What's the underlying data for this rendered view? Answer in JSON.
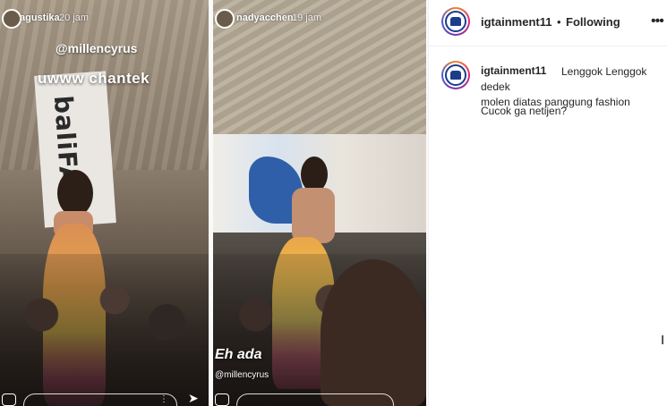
{
  "stories": [
    {
      "username": "agustika",
      "time": "20 jam",
      "mention": "@millencyrus",
      "caption": "uwww chantek",
      "banner_text": "baliFAS"
    },
    {
      "username": "nadyacchen",
      "time": "19 jam",
      "caption": "Eh ada",
      "mention": "@millencyrus"
    }
  ],
  "post": {
    "username": "igtainment11",
    "separator": "•",
    "follow_status": "Following",
    "caption_line1": "Lenggok Lenggok dedek",
    "caption_line2": "molen diatas panggung fashion",
    "caption_line3": "Cucok ga netijen?"
  },
  "icons": {
    "more": "more-options-icon",
    "avatar": "profile-avatar-icon",
    "camera": "camera-icon",
    "send": "send-icon"
  },
  "colors": {
    "text": "#262626",
    "border": "#efefef",
    "avatar_ring": "#1c3c8c"
  }
}
